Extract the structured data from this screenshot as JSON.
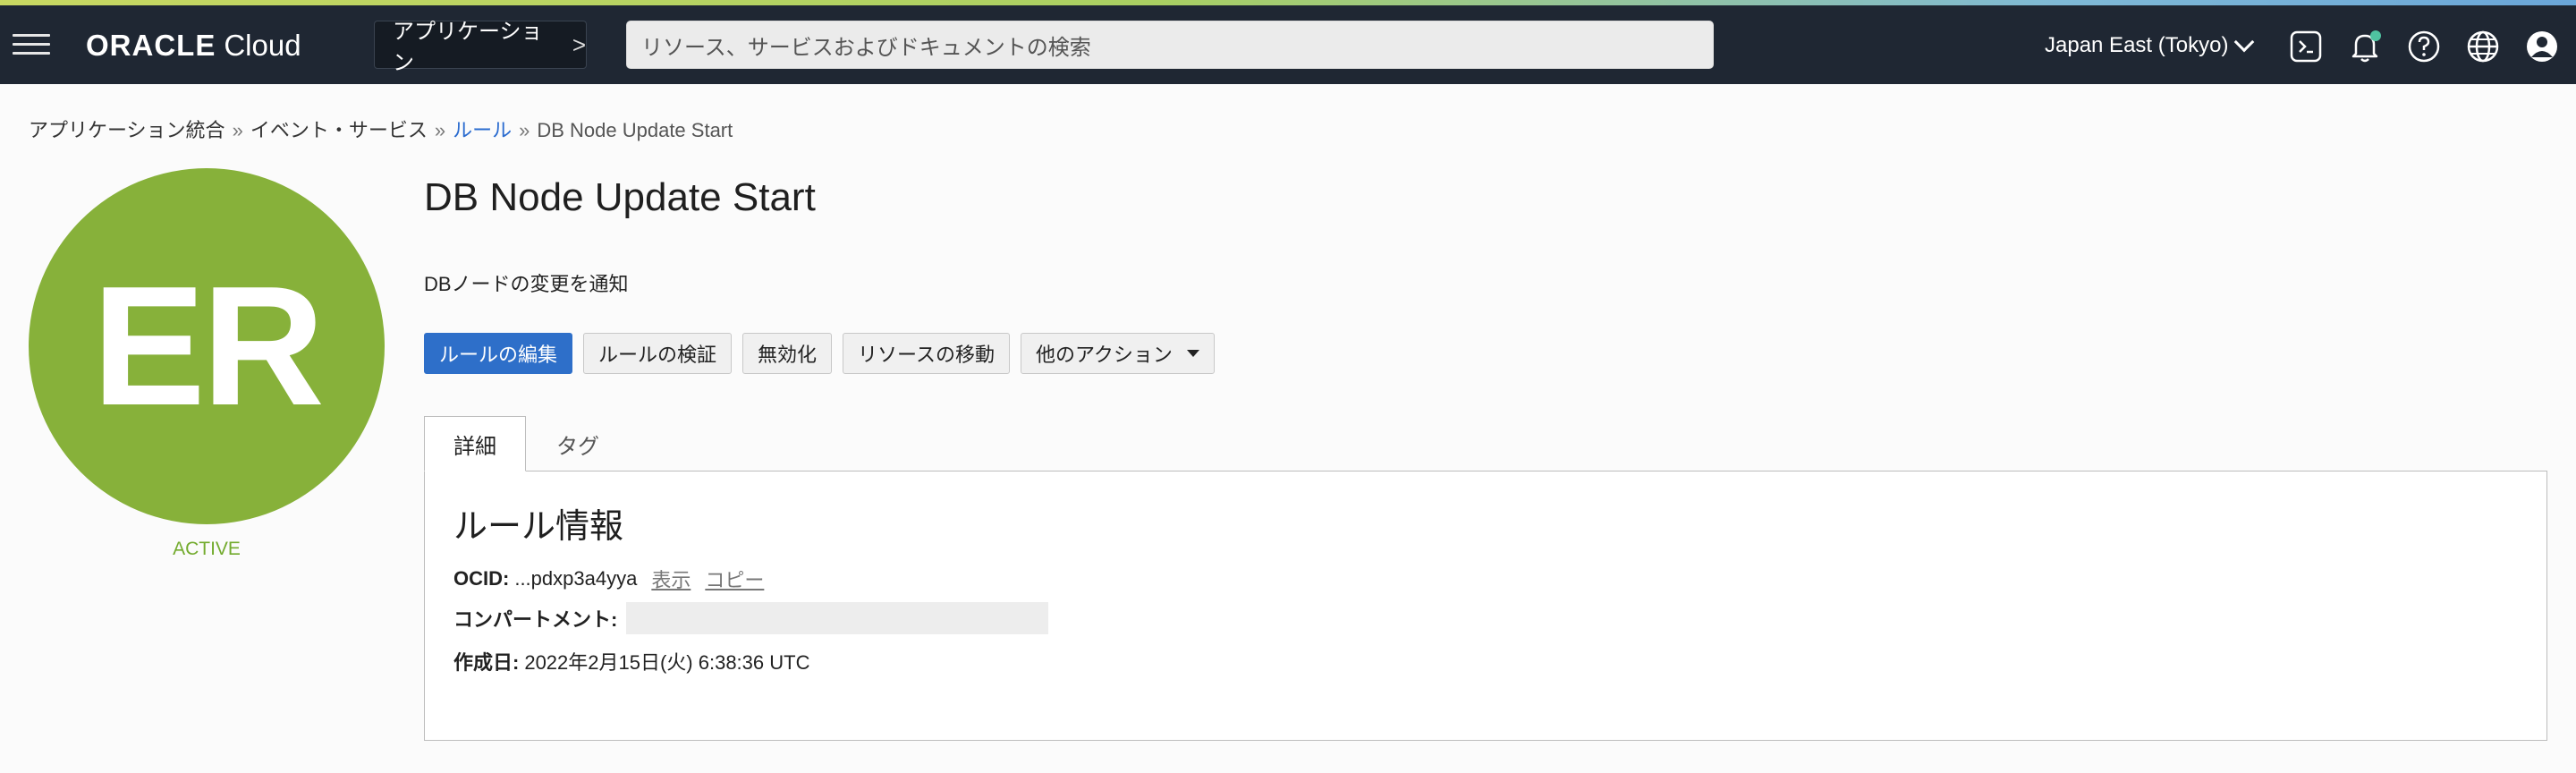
{
  "header": {
    "logo_brand": "ORACLE",
    "logo_product": "Cloud",
    "app_button_label": "アプリケーション",
    "search_placeholder": "リソース、サービスおよびドキュメントの検索",
    "region": "Japan East (Tokyo)",
    "icons": [
      "menu-icon",
      "cloud-shell-icon",
      "notification-bell-icon",
      "help-icon",
      "language-globe-icon",
      "profile-icon"
    ]
  },
  "breadcrumb": {
    "items": [
      "アプリケーション統合",
      "イベント・サービス",
      "ルール",
      "DB Node Update Start"
    ],
    "separator": "»"
  },
  "resource": {
    "avatar_initials": "ER",
    "avatar_color": "#87b13a",
    "status": "ACTIVE",
    "title": "DB Node Update Start",
    "description": "DBノードの変更を通知"
  },
  "actions": {
    "edit_rule": "ルールの編集",
    "validate_rule": "ルールの検証",
    "disable": "無効化",
    "move_resource": "リソースの移動",
    "more_actions": "他のアクション"
  },
  "tabs": [
    "詳細",
    "タグ"
  ],
  "rule_info": {
    "heading": "ルール情報",
    "ocid_label": "OCID:",
    "ocid_value": "...pdxp3a4yya",
    "show_link": "表示",
    "copy_link": "コピー",
    "compartment_label": "コンパートメント:",
    "created_label": "作成日:",
    "created_value": "2022年2月15日(火) 6:38:36 UTC"
  },
  "colors": {
    "header_bg": "#1f2733",
    "primary_button": "#2e6fc9",
    "link": "#2a6bcf",
    "active_status": "#73ab2e"
  }
}
